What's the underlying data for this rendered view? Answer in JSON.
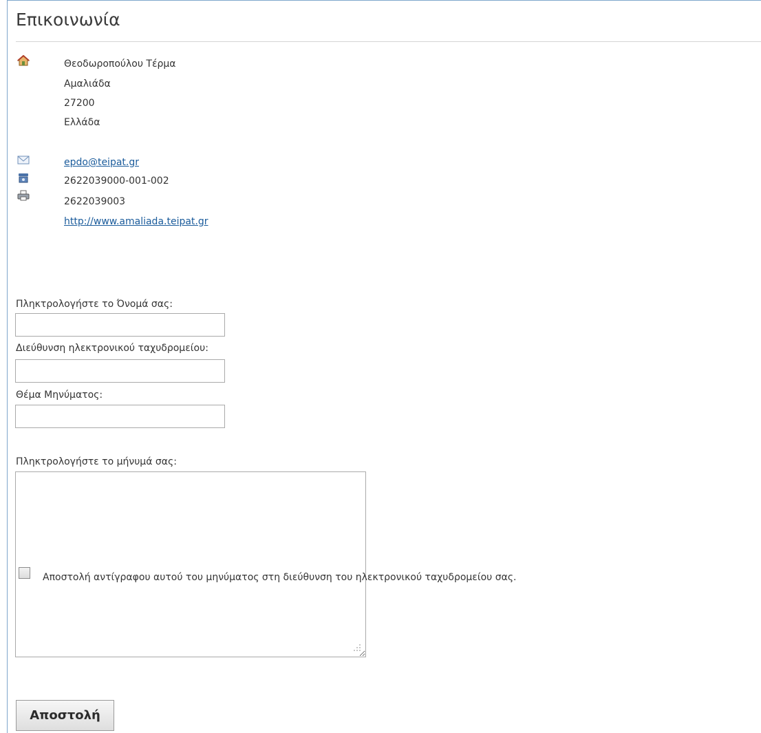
{
  "page": {
    "title": "Επικοινωνία"
  },
  "address": {
    "icon": "home-icon",
    "street": "Θεοδωροπούλου Τέρμα",
    "city": "Αμαλιάδα",
    "postal_code": "27200",
    "country": "Ελλάδα"
  },
  "contact": {
    "email": "epdo@teipat.gr",
    "email_icon": "envelope-icon",
    "phone": "2622039000-001-002",
    "phone_icon": "telephone-icon",
    "fax": "2622039003",
    "fax_icon": "fax-printer-icon",
    "website": "http://www.amaliada.teipat.gr"
  },
  "form": {
    "name_label": "Πληκτρολογήστε το Όνομά σας:",
    "name_value": "",
    "email_label": "Διεύθυνση ηλεκτρονικού ταχυδρομείου:",
    "email_value": "",
    "subject_label": "Θέμα Μηνύματος:",
    "subject_value": "",
    "message_label": "Πληκτρολογήστε το μήνυμά σας:",
    "message_value": "",
    "copy_checked": false,
    "copy_label": "Αποστολή αντίγραφου αυτού του μηνύματος στη διεύθυνση του ηλεκτρονικού ταχυδρομείου σας.",
    "submit_label": "Αποστολή"
  },
  "colors": {
    "link": "#1a5b9b",
    "frame_border": "#7ea6cc",
    "text": "#333333"
  }
}
